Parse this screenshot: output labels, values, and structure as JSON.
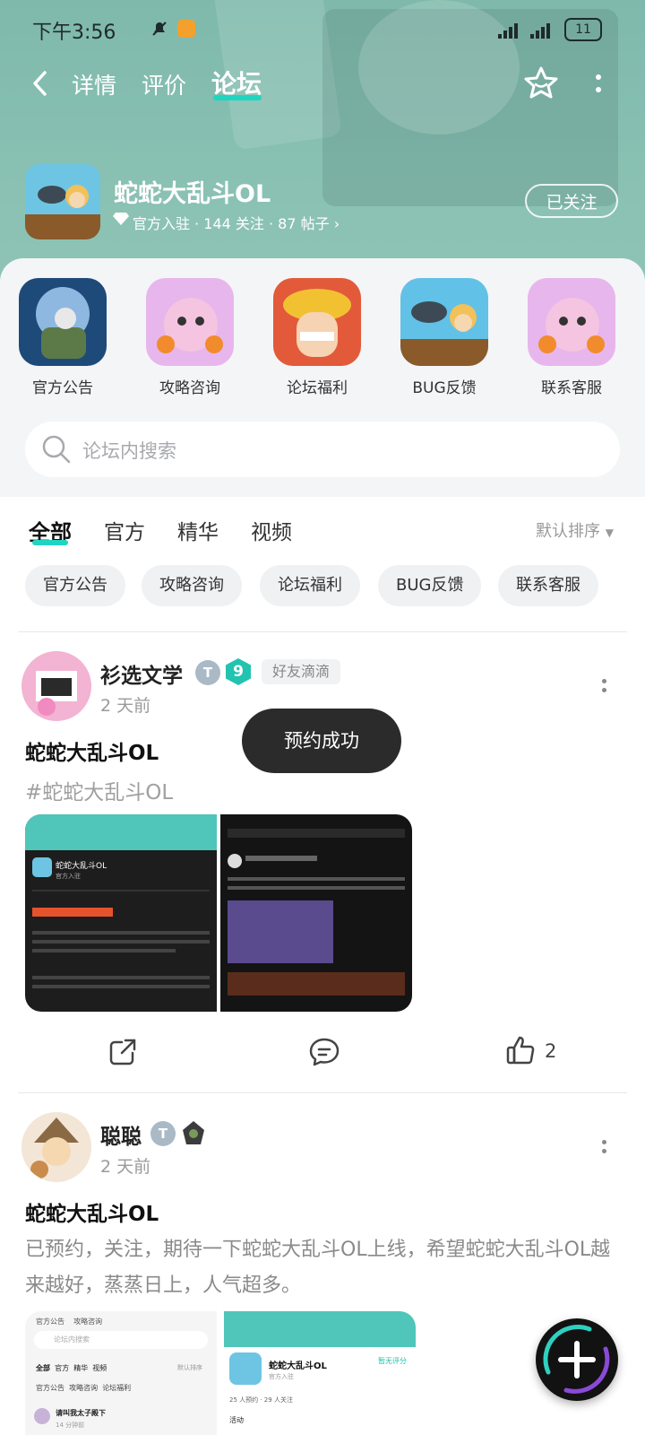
{
  "status_bar": {
    "time": "下午3:56",
    "battery": "11"
  },
  "nav": {
    "tabs": [
      {
        "label": "详情"
      },
      {
        "label": "评价"
      },
      {
        "label": "论坛"
      }
    ],
    "active_tab": "论坛"
  },
  "app": {
    "title": "蛇蛇大乱斗OL",
    "meta": "官方入驻 · 144 关注 · 87 帖子",
    "follow_label": "已关注"
  },
  "categories": [
    {
      "label": "官方公告"
    },
    {
      "label": "攻略咨询"
    },
    {
      "label": "论坛福利"
    },
    {
      "label": "BUG反馈"
    },
    {
      "label": "联系客服"
    }
  ],
  "search": {
    "placeholder": "论坛内搜索"
  },
  "feed_tabs": [
    {
      "label": "全部"
    },
    {
      "label": "官方"
    },
    {
      "label": "精华"
    },
    {
      "label": "视频"
    }
  ],
  "sort_label": "默认排序",
  "chips": [
    {
      "label": "官方公告"
    },
    {
      "label": "攻略咨询"
    },
    {
      "label": "论坛福利"
    },
    {
      "label": "BUG反馈"
    },
    {
      "label": "联系客服"
    }
  ],
  "toast": "预约成功",
  "posts": [
    {
      "author": "衫选文学",
      "time": "2 天前",
      "level": "9",
      "tag": "好友滴滴",
      "title": "蛇蛇大乱斗OL",
      "topic": "#蛇蛇大乱斗OL",
      "likes": "2"
    },
    {
      "author": "聪聪",
      "time": "2 天前",
      "title": "蛇蛇大乱斗OL",
      "body": "已预约，关注，期待一下蛇蛇大乱斗OL上线，希望蛇蛇大乱斗OL越来越好，蒸蒸日上，人气超多。"
    }
  ],
  "thumb_texts": {
    "game_name": "蛇蛇大乱斗OL",
    "official": "官方入驻",
    "sort": "默认排序",
    "search": "论坛内搜索",
    "user": "请叫我太子殿下",
    "time": "14 分钟前",
    "rating": "暂无评分",
    "stats": "25 人预约 · 29 人关注",
    "activity": "活动",
    "bug": "BUG反馈",
    "contact": "联系客服",
    "all": "全部",
    "guide": "攻略咨询",
    "welfare": "论坛福利",
    "notice": "官方公告",
    "tab_official": "官方",
    "tab_best": "精华",
    "tab_video": "视频"
  }
}
